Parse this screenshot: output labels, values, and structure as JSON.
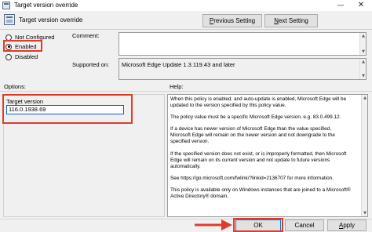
{
  "window": {
    "title": "Target version override",
    "minimize_glyph": "—",
    "close_glyph": "✕"
  },
  "header": {
    "title": "Target version override",
    "previous_setting_pre": "",
    "previous_setting_underline": "P",
    "previous_setting_post": "revious Setting",
    "next_setting_pre": "",
    "next_setting_underline": "N",
    "next_setting_post": "ext Setting"
  },
  "state": {
    "not_configured": "Not Configured",
    "enabled": "Enabled",
    "disabled": "Disabled",
    "selected": "enabled"
  },
  "fields": {
    "comment_label": "Comment:",
    "comment_value": "",
    "supported_label": "Supported on:",
    "supported_value": "Microsoft Edge Update 1.3.119.43 and later"
  },
  "panes": {
    "options_label": "Options:",
    "help_label": "Help:"
  },
  "options": {
    "target_version_label": "Target version",
    "target_version_value": "116.0.1938.69"
  },
  "help": {
    "paragraphs": [
      "When this policy is enabled, and auto-update is enabled, Microsoft Edge will be updated to the version specified by this policy value.",
      "The policy value must be a specific Microsoft Edge version, e.g. 83.0.499.12.",
      "If a device has newer version of Microsoft Edge than the value specified, Microsoft Edge will remain on the newer version and not downgrade to the specified version.",
      "If the specified version does not exist, or is improperly formatted, then Microsoft Edge will remain on its current version and not update to future versions automatically.",
      "See https://go.microsoft.com/fwlink/?linkid=2136707 for more information.",
      "This policy is available only on Windows instances that are joined to a Microsoft® Active Directory® domain."
    ]
  },
  "buttons": {
    "ok": "OK",
    "cancel": "Cancel",
    "apply_pre": "",
    "apply_underline": "A",
    "apply_post": "pply"
  },
  "icons": {
    "app": "policy-setting-icon",
    "arrow": "red-arrow-pointer",
    "highlight_color": "#e03c2b"
  }
}
